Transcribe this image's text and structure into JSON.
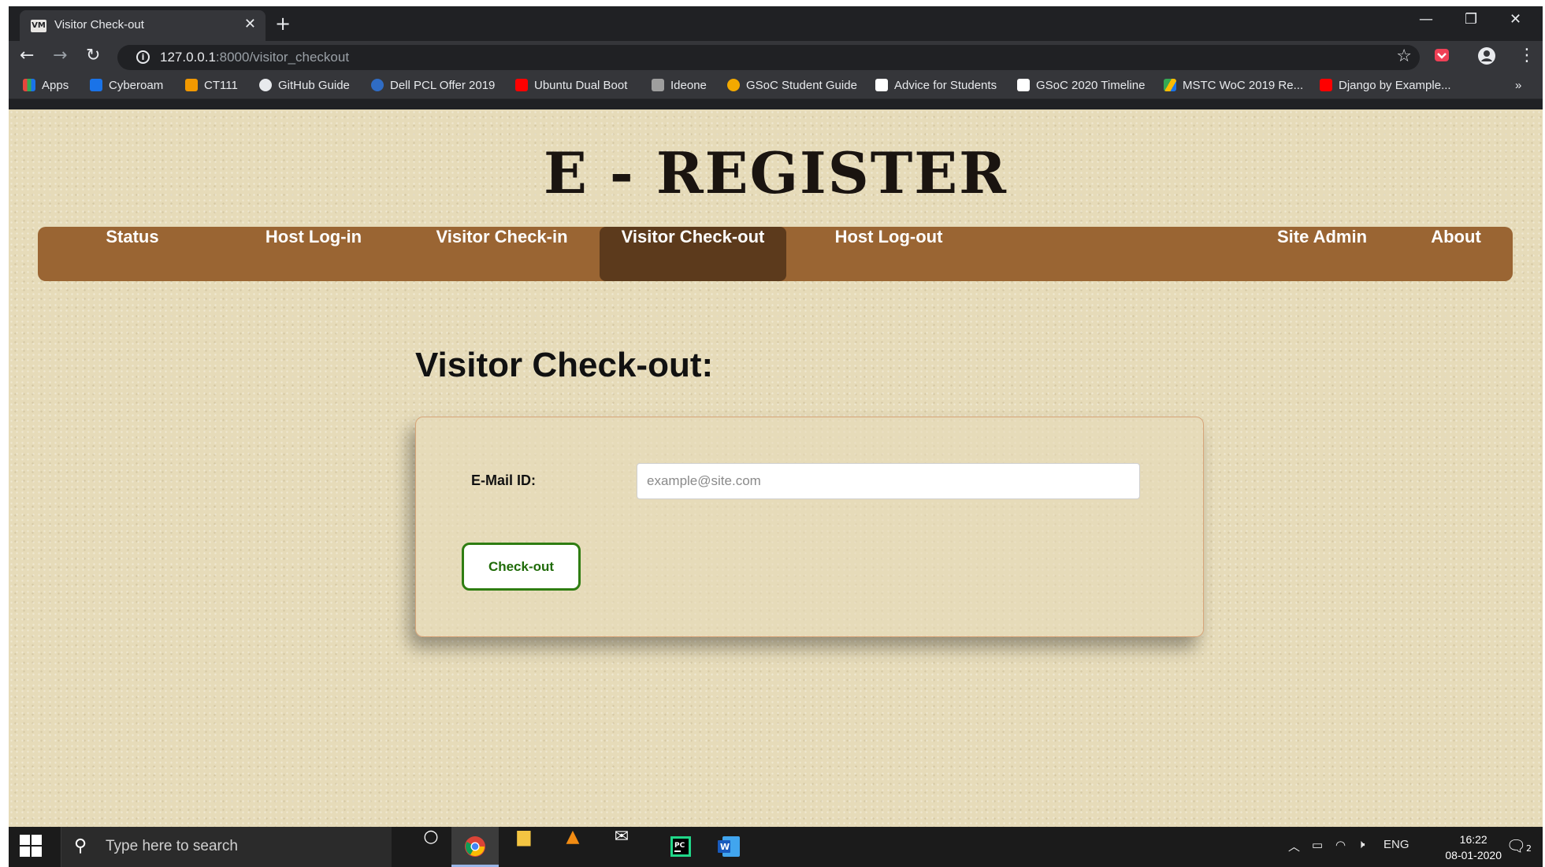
{
  "browser": {
    "tab_title": "Visitor Check-out",
    "tab_favicon": "VM",
    "url_host": "127.0.0.1",
    "url_path": ":8000/visitor_checkout"
  },
  "bookmarks": [
    {
      "label": "Apps",
      "color": "#e8453c"
    },
    {
      "label": "Cyberoam",
      "color": "#1a73e8"
    },
    {
      "label": "CT111",
      "color": "#f29900"
    },
    {
      "label": "GitHub Guide",
      "color": "#e8eaed"
    },
    {
      "label": "Dell PCL Offer 2019",
      "color": "#2f6cc4"
    },
    {
      "label": "Ubuntu Dual Boot",
      "color": "#ff0000"
    },
    {
      "label": "Ideone",
      "color": "#9e9e9e"
    },
    {
      "label": "GSoC Student Guide",
      "color": "#f2a900"
    },
    {
      "label": "Advice for Students",
      "color": "#ffffff"
    },
    {
      "label": "GSoC 2020 Timeline",
      "color": "#ffffff"
    },
    {
      "label": "MSTC WoC 2019 Re...",
      "color": "#34a853"
    },
    {
      "label": "Django by Example...",
      "color": "#ff0000"
    }
  ],
  "site": {
    "logo": "E - REGISTER",
    "nav": [
      {
        "label": "Status"
      },
      {
        "label": "Host Log-in"
      },
      {
        "label": "Visitor Check-in"
      },
      {
        "label": "Visitor Check-out"
      },
      {
        "label": "Host Log-out"
      },
      {
        "label": "Site Admin"
      },
      {
        "label": "About"
      }
    ],
    "page_title": "Visitor Check-out:",
    "form": {
      "email_label": "E-Mail ID:",
      "email_placeholder": "example@site.com",
      "email_value": "",
      "submit_label": "Check-out"
    }
  },
  "taskbar": {
    "search_placeholder": "Type here to search",
    "language": "ENG",
    "time": "16:22",
    "date": "08-01-2020",
    "notifications": "2"
  },
  "colors": {
    "nav_bg": "#9a6533",
    "nav_active": "#5c3a1c",
    "button_border": "#2f7d12",
    "page_bg": "#e6dbb9"
  }
}
